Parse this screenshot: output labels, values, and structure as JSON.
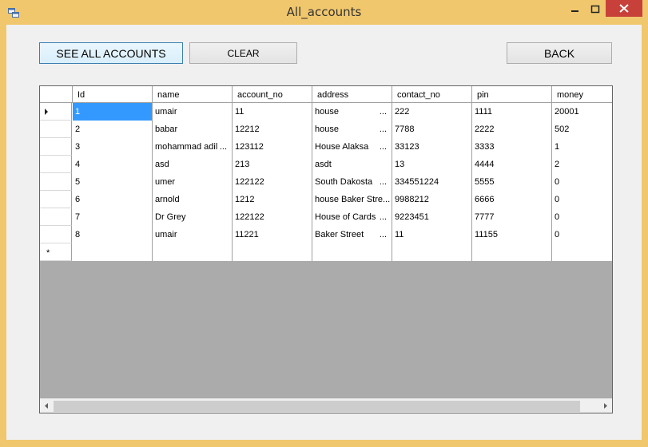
{
  "window": {
    "title": "All_accounts",
    "icon": "app-icon",
    "controls": [
      "minimize-icon",
      "maximize-icon",
      "close-icon"
    ]
  },
  "toolbar": {
    "see_all_label": "SEE ALL ACCOUNTS",
    "clear_label": "CLEAR",
    "back_label": "BACK"
  },
  "grid": {
    "columns": [
      "Id",
      "name",
      "account_no",
      "address",
      "contact_no",
      "pin",
      "money"
    ],
    "rows": [
      {
        "id": "1",
        "name": "umair",
        "account_no": "11",
        "address": "house",
        "contact_no": "222",
        "pin": "1111",
        "money": "20001"
      },
      {
        "id": "2",
        "name": "babar",
        "account_no": "12212",
        "address": "house",
        "contact_no": "7788",
        "pin": "2222",
        "money": "502"
      },
      {
        "id": "3",
        "name": "mohammad adil",
        "account_no": "123112",
        "address": "House Alaksa",
        "contact_no": "33123",
        "pin": "3333",
        "money": "1"
      },
      {
        "id": "4",
        "name": "asd",
        "account_no": "213",
        "address": "asdt",
        "contact_no": "13",
        "pin": "4444",
        "money": "2"
      },
      {
        "id": "5",
        "name": "umer",
        "account_no": "122122",
        "address": "South Dakosta",
        "contact_no": "334551224",
        "pin": "5555",
        "money": "0"
      },
      {
        "id": "6",
        "name": "arnold",
        "account_no": "1212",
        "address": "house Baker Stre...",
        "contact_no": "9988212",
        "pin": "6666",
        "money": "0"
      },
      {
        "id": "7",
        "name": "Dr Grey",
        "account_no": "122122",
        "address": "House of Cards",
        "contact_no": "9223451",
        "pin": "7777",
        "money": "0"
      },
      {
        "id": "8",
        "name": "umair",
        "account_no": "11221",
        "address": "Baker Street",
        "contact_no": "11",
        "pin": "11155",
        "money": "0"
      }
    ],
    "new_row_marker": "*",
    "ellipsis": "..."
  }
}
